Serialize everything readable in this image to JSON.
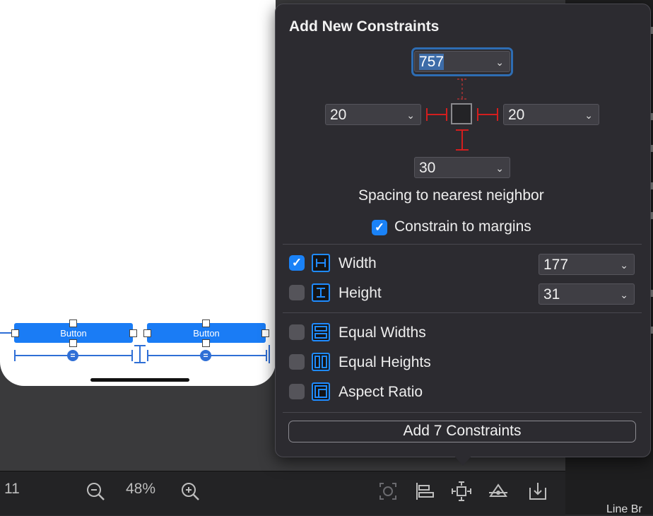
{
  "canvas": {
    "buttons": [
      {
        "label": "Button"
      },
      {
        "label": "Button"
      }
    ],
    "equal_marker": "="
  },
  "toolbar": {
    "left_value": "11",
    "zoom_out_icon": "zoom-out-icon",
    "zoom_level": "48%",
    "zoom_in_icon": "zoom-in-icon",
    "icons": [
      "update-frames-icon",
      "align-icon",
      "add-constraints-icon",
      "resolve-issues-icon",
      "embed-in-icon"
    ]
  },
  "right_panel": {
    "label": "Line Br"
  },
  "popover": {
    "title": "Add New Constraints",
    "top_value": "757",
    "leading_value": "20",
    "trailing_value": "20",
    "bottom_value": "30",
    "spacing_label": "Spacing to nearest neighbor",
    "constrain_to_margins": {
      "label": "Constrain to margins",
      "checked": true
    },
    "width": {
      "label": "Width",
      "checked": true,
      "value": "177"
    },
    "height": {
      "label": "Height",
      "checked": false,
      "value": "31"
    },
    "equal_widths": {
      "label": "Equal Widths",
      "checked": false
    },
    "equal_heights": {
      "label": "Equal Heights",
      "checked": false
    },
    "aspect_ratio": {
      "label": "Aspect Ratio",
      "checked": false
    },
    "add_button": "Add 7 Constraints",
    "chevron": "⌄",
    "check_mark": "✓"
  },
  "colors": {
    "accent": "#1a82f7",
    "constraint_red": "#d21e1e",
    "button_blue": "#1a7cf5"
  }
}
